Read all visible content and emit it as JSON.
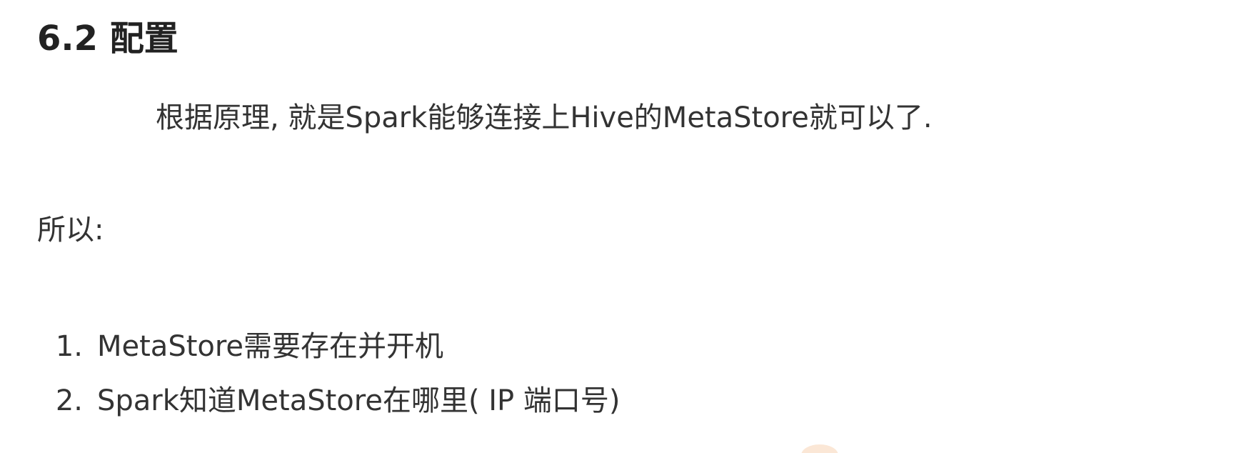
{
  "section": {
    "title": "6.2 配置"
  },
  "paragraphs": [
    "根据原理, 就是Spark能够连接上Hive的MetaStore就可以了.",
    "所以:"
  ],
  "list": [
    {
      "marker": "1.",
      "text": "MetaStore需要存在并开机"
    },
    {
      "marker": "2.",
      "text": "Spark知道MetaStore在哪里( IP 端口号)"
    }
  ],
  "colors": {
    "text": "#333333",
    "heading": "#222222",
    "background": "#ffffff"
  }
}
